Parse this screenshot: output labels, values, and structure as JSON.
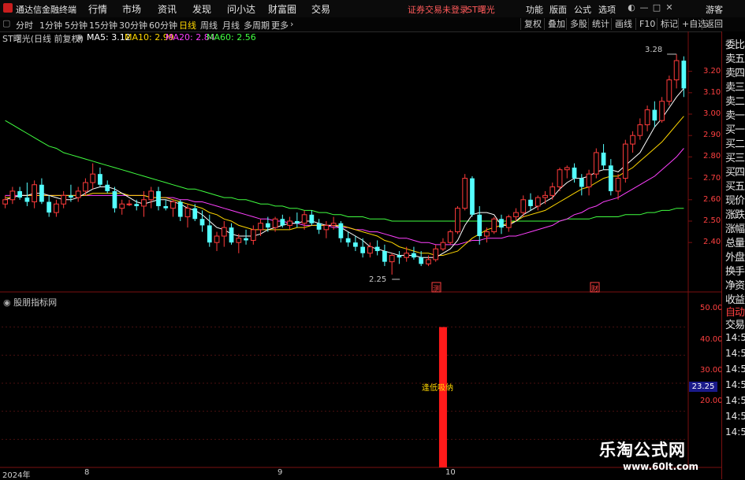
{
  "app": {
    "title": "通达信金融终端",
    "menus": [
      "行情",
      "市场",
      "资讯",
      "发现",
      "问小达",
      "财富圈",
      "交易"
    ],
    "login_status": "证券交易未登录",
    "stock_name": "ST曙光",
    "right_menus": [
      "功能",
      "版面",
      "公式",
      "选项"
    ],
    "guest": "游客",
    "window_buttons": [
      "—",
      "□",
      "✕"
    ]
  },
  "tabs": {
    "items": [
      "分时",
      "1分钟",
      "5分钟",
      "15分钟",
      "30分钟",
      "60分钟",
      "日线",
      "周线",
      "月线",
      "多周期",
      "更多"
    ],
    "active": "日线",
    "right_buttons": [
      "复权",
      "叠加",
      "多股",
      "统计",
      "画线",
      "F10",
      "标记",
      "+自选",
      "返回"
    ]
  },
  "legend": {
    "stock_label": "ST曙光(日线 前复权)",
    "ma5": "MA5: 3.12",
    "ma10": "MA10: 2.99",
    "ma20": "MA20: 2.84",
    "ma60": "MA60: 2.56",
    "colors": {
      "ma5": "#ffffff",
      "ma10": "#ffd700",
      "ma20": "#ff40ff",
      "ma60": "#40ff40"
    }
  },
  "side_panel": {
    "items": [
      "委比",
      "卖五",
      "卖四",
      "卖三",
      "卖二",
      "卖一",
      "买一",
      "买二",
      "买三",
      "买四",
      "买五",
      "现价",
      "涨跌",
      "涨幅",
      "总量",
      "外盘",
      "换手",
      "净资",
      "收益"
    ],
    "auto": "自动",
    "trade": "交易",
    "times": [
      "14:56",
      "14:56",
      "14:56",
      "14:56",
      "14:56",
      "14:56",
      "14:56"
    ]
  },
  "axis": {
    "price_ticks": [
      "3.20",
      "3.10",
      "3.00",
      "2.90",
      "2.80",
      "2.70",
      "2.60",
      "2.50",
      "2.40"
    ],
    "indicator_ticks": [
      "50.00",
      "40.00",
      "30.00",
      "20.00"
    ],
    "current_value": "23.25",
    "x_labels": [
      "2024年",
      "8",
      "9",
      "10"
    ]
  },
  "indicator": {
    "title": "股朋指标网",
    "signal_label": "逢低吸纳"
  },
  "chart_data": {
    "type": "candlestick",
    "price_range": [
      2.18,
      3.32
    ],
    "candles": [
      [
        2.58,
        2.62,
        2.56,
        2.6
      ],
      [
        2.6,
        2.66,
        2.58,
        2.64
      ],
      [
        2.64,
        2.66,
        2.6,
        2.61
      ],
      [
        2.61,
        2.68,
        2.57,
        2.59
      ],
      [
        2.59,
        2.69,
        2.56,
        2.67
      ],
      [
        2.67,
        2.7,
        2.58,
        2.59
      ],
      [
        2.59,
        2.62,
        2.52,
        2.54
      ],
      [
        2.54,
        2.6,
        2.52,
        2.58
      ],
      [
        2.58,
        2.64,
        2.56,
        2.62
      ],
      [
        2.62,
        2.67,
        2.59,
        2.61
      ],
      [
        2.61,
        2.66,
        2.59,
        2.64
      ],
      [
        2.64,
        2.7,
        2.62,
        2.68
      ],
      [
        2.68,
        2.77,
        2.65,
        2.72
      ],
      [
        2.72,
        2.75,
        2.66,
        2.67
      ],
      [
        2.67,
        2.69,
        2.63,
        2.64
      ],
      [
        2.64,
        2.66,
        2.54,
        2.56
      ],
      [
        2.56,
        2.6,
        2.53,
        2.58
      ],
      [
        2.58,
        2.6,
        2.57,
        2.58
      ],
      [
        2.58,
        2.6,
        2.55,
        2.57
      ],
      [
        2.57,
        2.64,
        2.52,
        2.6
      ],
      [
        2.6,
        2.66,
        2.56,
        2.64
      ],
      [
        2.64,
        2.66,
        2.55,
        2.57
      ],
      [
        2.57,
        2.6,
        2.55,
        2.56
      ],
      [
        2.56,
        2.6,
        2.52,
        2.59
      ],
      [
        2.59,
        2.6,
        2.5,
        2.52
      ],
      [
        2.52,
        2.58,
        2.47,
        2.56
      ],
      [
        2.56,
        2.58,
        2.5,
        2.51
      ],
      [
        2.51,
        2.55,
        2.45,
        2.48
      ],
      [
        2.48,
        2.53,
        2.38,
        2.4
      ],
      [
        2.4,
        2.45,
        2.36,
        2.43
      ],
      [
        2.43,
        2.5,
        2.38,
        2.47
      ],
      [
        2.47,
        2.49,
        2.39,
        2.4
      ],
      [
        2.4,
        2.44,
        2.35,
        2.42
      ],
      [
        2.42,
        2.46,
        2.39,
        2.41
      ],
      [
        2.41,
        2.48,
        2.39,
        2.46
      ],
      [
        2.46,
        2.51,
        2.43,
        2.49
      ],
      [
        2.49,
        2.52,
        2.45,
        2.47
      ],
      [
        2.47,
        2.52,
        2.45,
        2.51
      ],
      [
        2.51,
        2.53,
        2.47,
        2.48
      ],
      [
        2.48,
        2.52,
        2.46,
        2.5
      ],
      [
        2.5,
        2.54,
        2.47,
        2.49
      ],
      [
        2.49,
        2.55,
        2.46,
        2.53
      ],
      [
        2.53,
        2.55,
        2.48,
        2.49
      ],
      [
        2.49,
        2.51,
        2.44,
        2.46
      ],
      [
        2.46,
        2.5,
        2.42,
        2.48
      ],
      [
        2.48,
        2.52,
        2.46,
        2.49
      ],
      [
        2.49,
        2.5,
        2.4,
        2.42
      ],
      [
        2.42,
        2.45,
        2.38,
        2.4
      ],
      [
        2.4,
        2.43,
        2.36,
        2.38
      ],
      [
        2.38,
        2.42,
        2.33,
        2.35
      ],
      [
        2.35,
        2.4,
        2.33,
        2.38
      ],
      [
        2.38,
        2.41,
        2.34,
        2.36
      ],
      [
        2.36,
        2.39,
        2.29,
        2.31
      ],
      [
        2.31,
        2.35,
        2.25,
        2.34
      ],
      [
        2.34,
        2.36,
        2.3,
        2.33
      ],
      [
        2.33,
        2.38,
        2.31,
        2.35
      ],
      [
        2.35,
        2.38,
        2.32,
        2.33
      ],
      [
        2.33,
        2.36,
        2.29,
        2.3
      ],
      [
        2.3,
        2.34,
        2.29,
        2.32
      ],
      [
        2.32,
        2.39,
        2.31,
        2.37
      ],
      [
        2.37,
        2.42,
        2.36,
        2.4
      ],
      [
        2.4,
        2.46,
        2.39,
        2.45
      ],
      [
        2.45,
        2.57,
        2.44,
        2.56
      ],
      [
        2.56,
        2.72,
        2.55,
        2.7
      ],
      [
        2.7,
        2.71,
        2.52,
        2.53
      ],
      [
        2.53,
        2.57,
        2.39,
        2.43
      ],
      [
        2.43,
        2.47,
        2.4,
        2.45
      ],
      [
        2.45,
        2.52,
        2.44,
        2.51
      ],
      [
        2.51,
        2.53,
        2.44,
        2.47
      ],
      [
        2.47,
        2.53,
        2.45,
        2.52
      ],
      [
        2.52,
        2.56,
        2.5,
        2.54
      ],
      [
        2.54,
        2.62,
        2.52,
        2.6
      ],
      [
        2.6,
        2.63,
        2.55,
        2.57
      ],
      [
        2.57,
        2.62,
        2.55,
        2.61
      ],
      [
        2.61,
        2.64,
        2.58,
        2.62
      ],
      [
        2.62,
        2.68,
        2.6,
        2.66
      ],
      [
        2.66,
        2.75,
        2.64,
        2.74
      ],
      [
        2.74,
        2.76,
        2.7,
        2.75
      ],
      [
        2.75,
        2.77,
        2.68,
        2.7
      ],
      [
        2.7,
        2.72,
        2.62,
        2.66
      ],
      [
        2.66,
        2.74,
        2.62,
        2.72
      ],
      [
        2.72,
        2.84,
        2.7,
        2.82
      ],
      [
        2.82,
        2.86,
        2.74,
        2.76
      ],
      [
        2.76,
        2.79,
        2.62,
        2.64
      ],
      [
        2.64,
        2.72,
        2.6,
        2.7
      ],
      [
        2.7,
        2.88,
        2.68,
        2.86
      ],
      [
        2.86,
        2.92,
        2.82,
        2.9
      ],
      [
        2.9,
        2.98,
        2.88,
        2.95
      ],
      [
        2.95,
        3.04,
        2.92,
        3.02
      ],
      [
        3.02,
        3.06,
        2.94,
        2.97
      ],
      [
        2.97,
        3.08,
        2.96,
        3.06
      ],
      [
        3.06,
        3.18,
        3.04,
        3.16
      ],
      [
        3.16,
        3.28,
        3.12,
        3.25
      ],
      [
        3.25,
        3.27,
        3.08,
        3.12
      ]
    ],
    "ma_lines": {
      "ma5": [
        2.6,
        2.61,
        2.62,
        2.62,
        2.63,
        2.63,
        2.62,
        2.61,
        2.6,
        2.6,
        2.61,
        2.63,
        2.65,
        2.66,
        2.66,
        2.65,
        2.63,
        2.61,
        2.59,
        2.58,
        2.59,
        2.6,
        2.6,
        2.59,
        2.58,
        2.56,
        2.55,
        2.53,
        2.5,
        2.47,
        2.46,
        2.44,
        2.43,
        2.43,
        2.43,
        2.44,
        2.46,
        2.47,
        2.48,
        2.49,
        2.49,
        2.5,
        2.5,
        2.49,
        2.48,
        2.48,
        2.47,
        2.45,
        2.43,
        2.41,
        2.38,
        2.37,
        2.36,
        2.35,
        2.34,
        2.34,
        2.34,
        2.33,
        2.33,
        2.33,
        2.35,
        2.37,
        2.41,
        2.48,
        2.53,
        2.54,
        2.54,
        2.53,
        2.48,
        2.48,
        2.5,
        2.53,
        2.55,
        2.57,
        2.59,
        2.61,
        2.65,
        2.68,
        2.7,
        2.7,
        2.71,
        2.73,
        2.74,
        2.74,
        2.73,
        2.76,
        2.79,
        2.82,
        2.88,
        2.94,
        2.98,
        3.03,
        3.08,
        3.12
      ],
      "ma10": [
        2.61,
        2.61,
        2.62,
        2.62,
        2.62,
        2.62,
        2.62,
        2.62,
        2.62,
        2.62,
        2.62,
        2.62,
        2.63,
        2.63,
        2.63,
        2.63,
        2.63,
        2.62,
        2.62,
        2.62,
        2.61,
        2.61,
        2.61,
        2.6,
        2.59,
        2.58,
        2.57,
        2.56,
        2.54,
        2.53,
        2.51,
        2.5,
        2.48,
        2.47,
        2.46,
        2.46,
        2.46,
        2.46,
        2.46,
        2.46,
        2.47,
        2.47,
        2.48,
        2.48,
        2.48,
        2.48,
        2.48,
        2.47,
        2.46,
        2.45,
        2.44,
        2.43,
        2.41,
        2.4,
        2.38,
        2.37,
        2.36,
        2.35,
        2.35,
        2.34,
        2.34,
        2.35,
        2.36,
        2.39,
        2.42,
        2.44,
        2.46,
        2.47,
        2.48,
        2.49,
        2.5,
        2.52,
        2.53,
        2.54,
        2.55,
        2.57,
        2.59,
        2.61,
        2.63,
        2.65,
        2.66,
        2.68,
        2.7,
        2.71,
        2.71,
        2.73,
        2.75,
        2.78,
        2.81,
        2.84,
        2.87,
        2.91,
        2.95,
        2.99
      ],
      "ma20": [
        2.62,
        2.62,
        2.62,
        2.62,
        2.62,
        2.62,
        2.62,
        2.62,
        2.62,
        2.62,
        2.62,
        2.62,
        2.62,
        2.62,
        2.62,
        2.62,
        2.62,
        2.62,
        2.62,
        2.62,
        2.61,
        2.61,
        2.61,
        2.61,
        2.6,
        2.6,
        2.59,
        2.59,
        2.58,
        2.57,
        2.56,
        2.55,
        2.54,
        2.53,
        2.52,
        2.51,
        2.51,
        2.5,
        2.5,
        2.49,
        2.49,
        2.48,
        2.48,
        2.48,
        2.48,
        2.47,
        2.47,
        2.47,
        2.46,
        2.46,
        2.45,
        2.45,
        2.44,
        2.43,
        2.42,
        2.42,
        2.41,
        2.4,
        2.4,
        2.39,
        2.39,
        2.39,
        2.39,
        2.4,
        2.41,
        2.41,
        2.42,
        2.42,
        2.42,
        2.43,
        2.43,
        2.44,
        2.45,
        2.46,
        2.47,
        2.48,
        2.5,
        2.51,
        2.53,
        2.54,
        2.56,
        2.57,
        2.59,
        2.6,
        2.61,
        2.63,
        2.65,
        2.67,
        2.69,
        2.71,
        2.74,
        2.77,
        2.8,
        2.84
      ],
      "ma60": [
        2.97,
        2.95,
        2.93,
        2.91,
        2.89,
        2.87,
        2.85,
        2.84,
        2.82,
        2.81,
        2.8,
        2.79,
        2.78,
        2.77,
        2.76,
        2.75,
        2.74,
        2.73,
        2.72,
        2.71,
        2.7,
        2.69,
        2.68,
        2.67,
        2.66,
        2.65,
        2.65,
        2.64,
        2.63,
        2.62,
        2.61,
        2.61,
        2.6,
        2.6,
        2.59,
        2.58,
        2.58,
        2.57,
        2.57,
        2.56,
        2.56,
        2.55,
        2.55,
        2.54,
        2.54,
        2.53,
        2.53,
        2.52,
        2.52,
        2.52,
        2.51,
        2.51,
        2.51,
        2.5,
        2.5,
        2.5,
        2.5,
        2.5,
        2.5,
        2.5,
        2.5,
        2.5,
        2.5,
        2.5,
        2.5,
        2.5,
        2.5,
        2.5,
        2.5,
        2.5,
        2.5,
        2.5,
        2.5,
        2.5,
        2.5,
        2.5,
        2.5,
        2.51,
        2.51,
        2.51,
        2.51,
        2.52,
        2.52,
        2.52,
        2.52,
        2.53,
        2.53,
        2.53,
        2.54,
        2.54,
        2.55,
        2.55,
        2.56,
        2.56
      ]
    },
    "low_label": "2.25",
    "high_label": "3.28",
    "events": [
      "测",
      "财"
    ],
    "indicator_range": [
      0,
      60
    ],
    "indicator_bar": {
      "index": 60,
      "value": 50
    }
  }
}
